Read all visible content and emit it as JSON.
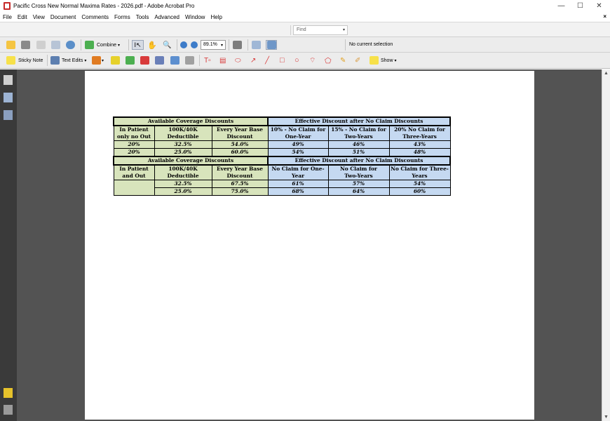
{
  "window": {
    "title": "Pacific Cross New Normal Maxima Rates - 2026.pdf - Adobe Acrobat Pro",
    "minimize": "—",
    "maximize": "☐",
    "close": "✕"
  },
  "menu": {
    "items": [
      "File",
      "Edit",
      "View",
      "Document",
      "Comments",
      "Forms",
      "Tools",
      "Advanced",
      "Window",
      "Help"
    ],
    "close_doc": "×"
  },
  "find": {
    "placeholder": "Find"
  },
  "toolbar1": {
    "combine_label": "Combine",
    "zoom_value": "89.1%",
    "selection_status": "No current selection"
  },
  "toolbar2": {
    "sticky_note_label": "Sticky Note",
    "text_edits_label": "Text Edits",
    "show_label": "Show"
  },
  "table": {
    "section1": {
      "left_header": "Available Coverage Discounts",
      "right_header": "Effective Discount after No Claim Discounts",
      "col_headers": [
        [
          "In Patient",
          "only no Out"
        ],
        [
          "100K/40K",
          "Deductible"
        ],
        [
          "Every Year Base",
          "Discount"
        ],
        [
          "10% - No Claim for",
          "One-Year"
        ],
        [
          "15% - No Claim for",
          "Two-Years"
        ],
        [
          "20% No Claim for",
          "Three-Years"
        ]
      ],
      "rows": [
        [
          "20%",
          "32.5%",
          "54.0%",
          "49%",
          "46%",
          "43%"
        ],
        [
          "20%",
          "25.0%",
          "60.0%",
          "54%",
          "51%",
          "48%"
        ]
      ]
    },
    "section2": {
      "left_header": "Available Coverage Discounts",
      "right_header": "Effective Discount after No Claim Discounts",
      "col_headers": [
        [
          "In Patient",
          "and Out"
        ],
        [
          "100K/40K",
          "Deductible"
        ],
        [
          "Every Year Base",
          "Discount"
        ],
        [
          "No Claim for One-",
          "Year"
        ],
        [
          "No Claim for",
          "Two-Years"
        ],
        [
          "No Claim for Three-",
          "Years"
        ]
      ],
      "rows": [
        [
          "",
          "32.5%",
          "67.5%",
          "61%",
          "57%",
          "54%"
        ],
        [
          "",
          "25.0%",
          "75.0%",
          "68%",
          "64%",
          "60%"
        ]
      ]
    }
  }
}
